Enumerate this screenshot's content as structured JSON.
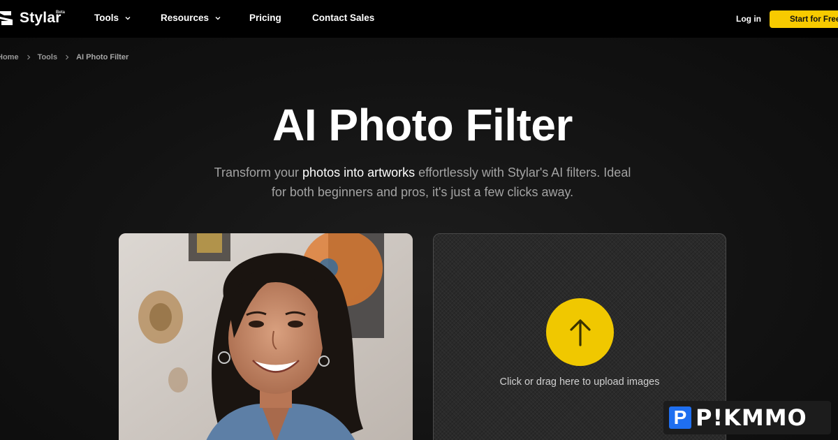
{
  "header": {
    "logo_text": "Stylar",
    "logo_badge": "Beta",
    "nav": [
      {
        "label": "Tools",
        "has_dropdown": true
      },
      {
        "label": "Resources",
        "has_dropdown": true
      },
      {
        "label": "Pricing",
        "has_dropdown": false
      },
      {
        "label": "Contact Sales",
        "has_dropdown": false
      }
    ],
    "login_label": "Log in",
    "cta_label": "Start for Free"
  },
  "breadcrumb": [
    "Home",
    "Tools",
    "AI Photo Filter"
  ],
  "hero": {
    "title": "AI Photo Filter",
    "subtitle_part1": "Transform your ",
    "subtitle_highlight": "photos into artworks",
    "subtitle_part2": " effortlessly with Stylar's AI filters. Ideal for both beginners and pros, it's just a few clicks away."
  },
  "upload": {
    "instruction": "Click or drag here to upload images"
  },
  "watermark": {
    "letter": "P",
    "text": "P!KMMO"
  },
  "colors": {
    "accent": "#f7ca00",
    "background": "#0b0b0b",
    "upload_circle": "#f0c800"
  },
  "icons": [
    "stylar-logo-icon",
    "chevron-down-icon",
    "chevron-right-icon",
    "upload-arrow-icon"
  ]
}
